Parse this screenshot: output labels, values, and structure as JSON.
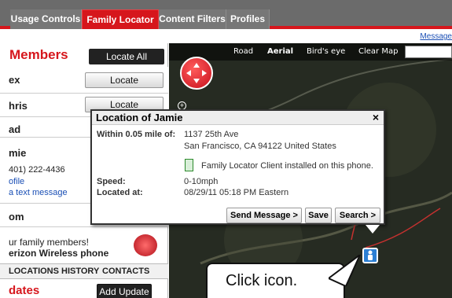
{
  "tabs": [
    {
      "label": "Usage Controls"
    },
    {
      "label": "Family Locator"
    },
    {
      "label": "Content Filters"
    },
    {
      "label": "Profiles"
    }
  ],
  "messages_link": "Message",
  "panel": {
    "title": "Members",
    "locate_all": "Locate All",
    "members": [
      {
        "name": "ex",
        "button": "Locate"
      },
      {
        "name": "hris",
        "button": "Locate"
      },
      {
        "name": "ad",
        "button": ""
      },
      {
        "name": "mie",
        "button": ""
      },
      {
        "name": "om",
        "button": ""
      }
    ],
    "phone": "401) 222-4436",
    "profile_link": "ofile",
    "text_link": "a text message",
    "promo_line1": "ur family members!",
    "promo_line2": "erizon Wireless phone",
    "bottom_tabs": [
      "LOCATIONS",
      "HISTORY",
      "CONTACTS"
    ],
    "updates_title": "dates",
    "add_update": "Add Update"
  },
  "map": {
    "options": [
      "Road",
      "Aerial",
      "Bird's eye",
      "Clear Map"
    ],
    "selected": "Aerial"
  },
  "popup": {
    "title": "Location of Jamie",
    "within_label": "Within 0.05 mile of:",
    "address1": "1137 25th Ave",
    "address2": "San Francisco, CA 94122 United States",
    "client_text": "Family Locator Client installed on this phone.",
    "speed_label": "Speed:",
    "speed": "0-10mph",
    "located_label": "Located at:",
    "located": "08/29/11 05:18 PM Eastern",
    "buttons": [
      "Send Message >",
      "Save",
      "Search >"
    ]
  },
  "callout": {
    "text": "Click icon."
  }
}
